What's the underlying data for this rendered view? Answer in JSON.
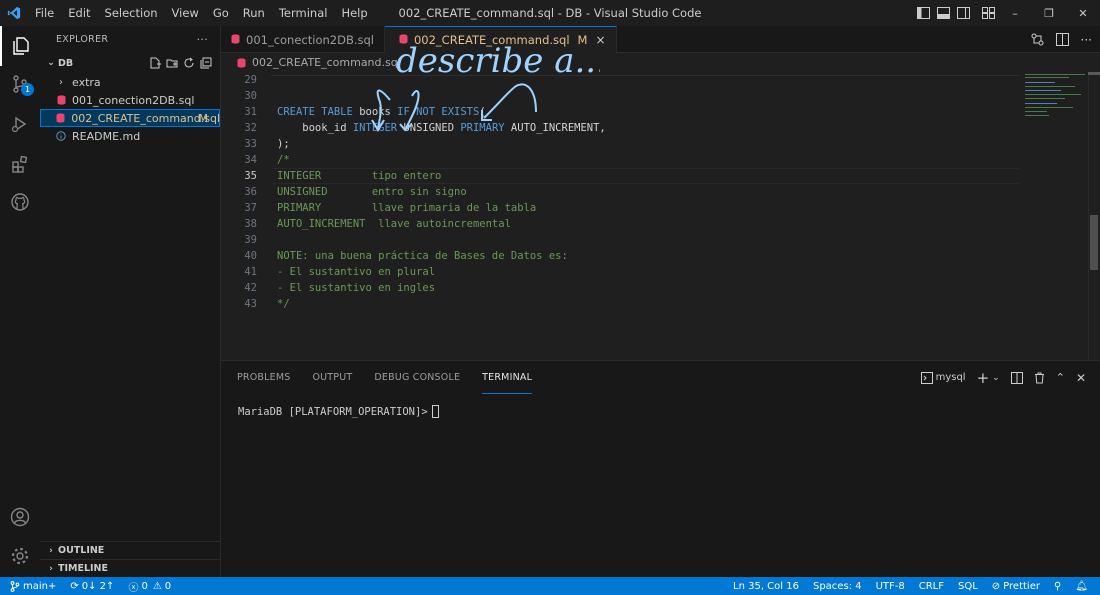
{
  "window": {
    "title": "002_CREATE_command.sql - DB - Visual Studio Code",
    "menu": [
      "File",
      "Edit",
      "Selection",
      "View",
      "Go",
      "Run",
      "Terminal",
      "Help"
    ]
  },
  "sidebar": {
    "header": "EXPLORER",
    "more": "···",
    "folder": "DB",
    "items": [
      {
        "label": "extra",
        "type": "folder"
      },
      {
        "label": "001_conection2DB.sql",
        "type": "sql"
      },
      {
        "label": "002_CREATE_command.sql",
        "type": "sql",
        "modified": "M"
      },
      {
        "label": "README.md",
        "type": "info"
      }
    ],
    "outline": "OUTLINE",
    "timeline": "TIMELINE"
  },
  "activity": {
    "scm_badge": "1"
  },
  "tabs": [
    {
      "label": "001_conection2DB.sql",
      "active": false
    },
    {
      "label": "002_CREATE_command.sql",
      "active": true,
      "modified": "M",
      "close": "×"
    }
  ],
  "breadcrumb": "002_CREATE_command.sql",
  "editor": {
    "lines": [
      {
        "n": "29",
        "segments": []
      },
      {
        "n": "30",
        "segments": []
      },
      {
        "n": "31",
        "segments": [
          {
            "t": "CREATE TABLE ",
            "c": "kw"
          },
          {
            "t": "books ",
            "c": "id"
          },
          {
            "t": "IF NOT EXISTS",
            "c": "kw"
          },
          {
            "t": "(",
            "c": "id"
          }
        ]
      },
      {
        "n": "32",
        "segments": [
          {
            "t": "    book_id ",
            "c": "id"
          },
          {
            "t": "INTEGER",
            "c": "kw"
          },
          {
            "t": " UNSIGNED ",
            "c": "id"
          },
          {
            "t": "PRIMARY",
            "c": "kw"
          },
          {
            "t": " AUTO_INCREMENT,",
            "c": "id"
          }
        ]
      },
      {
        "n": "33",
        "segments": [
          {
            "t": ");",
            "c": "id"
          }
        ]
      },
      {
        "n": "34",
        "segments": [
          {
            "t": "/*",
            "c": "cm"
          }
        ]
      },
      {
        "n": "35",
        "segments": [
          {
            "t": "INTEGER        tipo entero",
            "c": "cm"
          }
        ],
        "current": true
      },
      {
        "n": "36",
        "segments": [
          {
            "t": "UNSIGNED       entro sin signo",
            "c": "cm"
          }
        ]
      },
      {
        "n": "37",
        "segments": [
          {
            "t": "PRIMARY        llave primaria de la tabla",
            "c": "cm"
          }
        ]
      },
      {
        "n": "38",
        "segments": [
          {
            "t": "AUTO_INCREMENT  llave autoincremental",
            "c": "cm"
          }
        ]
      },
      {
        "n": "39",
        "segments": []
      },
      {
        "n": "40",
        "segments": [
          {
            "t": "NOTE: una buena práctica de Bases de Datos es:",
            "c": "cm"
          }
        ]
      },
      {
        "n": "41",
        "segments": [
          {
            "t": "- El sustantivo en plural",
            "c": "cm"
          }
        ]
      },
      {
        "n": "42",
        "segments": [
          {
            "t": "- El sustantivo en ingles",
            "c": "cm"
          }
        ]
      },
      {
        "n": "43",
        "segments": [
          {
            "t": "*/",
            "c": "cm"
          }
        ]
      }
    ],
    "annotation": "describe a..."
  },
  "panel": {
    "tabs": [
      "PROBLEMS",
      "OUTPUT",
      "DEBUG CONSOLE",
      "TERMINAL"
    ],
    "active_tab": "TERMINAL",
    "terminal_name": "mysql",
    "prompt": "MariaDB [PLATAFORM_OPERATION]>"
  },
  "status": {
    "branch": "main+",
    "sync": "0↓ 2↑",
    "errors": "0",
    "warnings": "0",
    "position": "Ln 35, Col 16",
    "spaces": "Spaces: 4",
    "encoding": "UTF-8",
    "eol": "CRLF",
    "language": "SQL",
    "prettier": "Prettier"
  },
  "colors": {
    "accent": "#0078d4",
    "keyword": "#569cd6",
    "comment": "#6a9955",
    "modified": "#e2c08d",
    "sql_icon": "#e8466d"
  }
}
